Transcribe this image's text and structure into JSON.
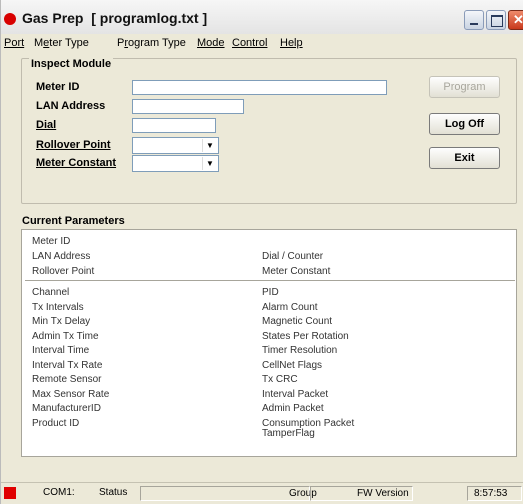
{
  "window": {
    "title": "Gas Prep  [ programlog.txt ]"
  },
  "menu": {
    "port": "Port",
    "meter_type_prefix": "M",
    "meter_type_accel": "e",
    "meter_type_rest": "ter Type",
    "program_type_prefix": "P",
    "program_type_accel": "r",
    "program_type_rest": "ogram Type",
    "mode": "Mode",
    "control": "Control",
    "help": "Help"
  },
  "inspect": {
    "title": "Inspect Module",
    "meter_id_label": "Meter ID",
    "meter_id_value": "",
    "lan_address_label": "LAN Address",
    "lan_address_value": "",
    "dial_label": "Dial",
    "dial_value": "",
    "rollover_point_label": "Rollover Point",
    "rollover_point_value": "",
    "meter_constant_label": "Meter Constant",
    "meter_constant_value": ""
  },
  "buttons": {
    "program": "Program",
    "log_off": "Log Off",
    "exit": "Exit"
  },
  "parameters": {
    "title": "Current Parameters",
    "top_left": [
      "Meter ID",
      "LAN Address",
      "Rollover Point"
    ],
    "top_right": [
      "",
      "Dial / Counter",
      "Meter Constant"
    ],
    "left": [
      "Channel",
      "Tx Intervals",
      "Min Tx Delay",
      "Admin Tx Time",
      "Interval Time",
      "Interval Tx Rate",
      "Remote Sensor",
      "Max Sensor Rate",
      "ManufacturerID",
      "Product ID"
    ],
    "right": [
      "PID",
      "Alarm Count",
      "Magnetic Count",
      "States Per Rotation",
      "Timer Resolution",
      "CellNet Flags",
      "Tx CRC",
      "Interval Packet",
      "Admin Packet",
      "Consumption Packet",
      "TamperFlag"
    ]
  },
  "status": {
    "port": "COM1:",
    "status": "Status",
    "group": "Group",
    "fw_version": "FW Version",
    "time": "8:57:53"
  },
  "colors": {
    "led": "#e00000",
    "window_bg": "#ECE9D8"
  }
}
